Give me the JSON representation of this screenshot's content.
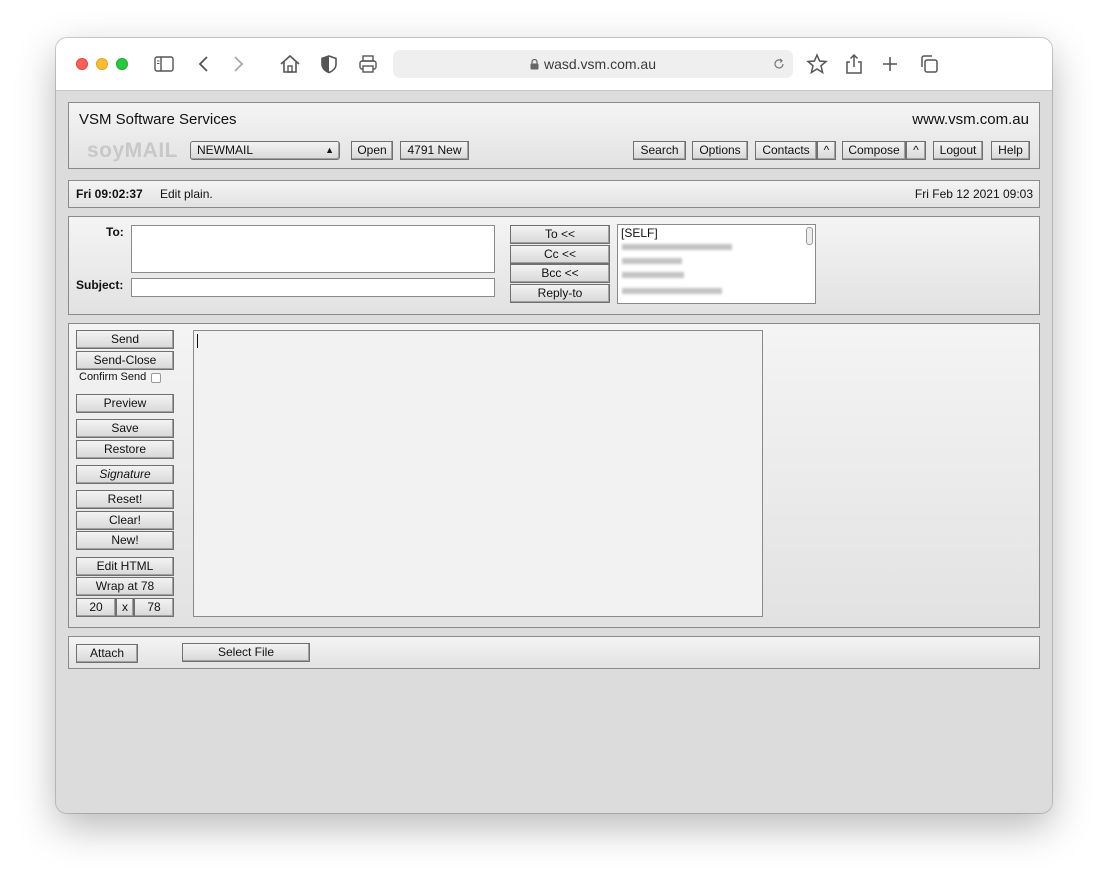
{
  "browser": {
    "url": "wasd.vsm.com.au"
  },
  "header": {
    "company": "VSM Software Services",
    "website": "www.vsm.com.au",
    "logo_text": "soyMAIL",
    "folder_selected": "NEWMAIL",
    "open_label": "Open",
    "new_count_label": "4791 New",
    "nav": {
      "search": "Search",
      "options": "Options",
      "contacts": "Contacts",
      "contacts_caret": "^",
      "compose": "Compose",
      "compose_caret": "^",
      "logout": "Logout",
      "help": "Help"
    }
  },
  "status": {
    "time": "Fri 09:02:37",
    "mode": "Edit plain.",
    "date": "Fri Feb 12 2021 09:03"
  },
  "addressing": {
    "to_label": "To:",
    "subject_label": "Subject:",
    "to_value": "",
    "subject_value": "",
    "to_button": "To <<",
    "cc_button": "Cc <<",
    "bcc_button": "Bcc <<",
    "replyto_button": "Reply-to",
    "contacts_first": "[SELF]"
  },
  "compose_actions": {
    "send": "Send",
    "send_close": "Send-Close",
    "confirm_send": "Confirm Send",
    "preview": "Preview",
    "save": "Save",
    "restore": "Restore",
    "signature": "Signature",
    "reset": "Reset!",
    "clear": "Clear!",
    "new": "New!",
    "edit_html": "Edit HTML",
    "wrap": "Wrap at 78",
    "rows": "20",
    "x": "x",
    "cols": "78"
  },
  "body_value": "",
  "attach": {
    "attach_label": "Attach",
    "select_file_label": "Select File"
  }
}
